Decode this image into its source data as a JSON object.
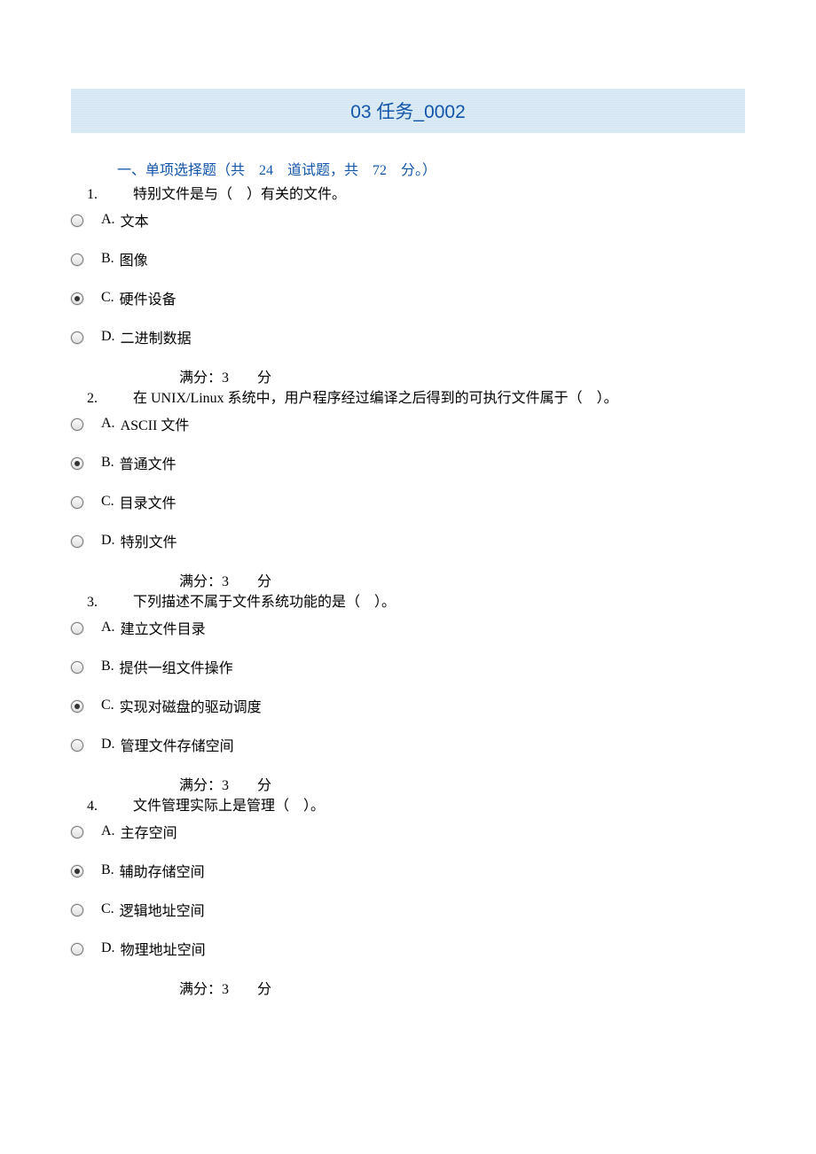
{
  "title": "03 任务_0002",
  "section_header": "一、单项选择题（共　24　道试题，共　72　分。）",
  "score_label_prefix": "满分：",
  "score_value": "3",
  "score_label_suffix": "分",
  "questions": [
    {
      "num": "1.",
      "text": "特别文件是与（　）有关的文件。",
      "options": [
        {
          "label": "A.",
          "text": "文本",
          "selected": false
        },
        {
          "label": "B.",
          "text": "图像",
          "selected": false
        },
        {
          "label": "C.",
          "text": "硬件设备",
          "selected": true
        },
        {
          "label": "D.",
          "text": "二进制数据",
          "selected": false
        }
      ]
    },
    {
      "num": "2.",
      "text": "在 UNIX/Linux 系统中，用户程序经过编译之后得到的可执行文件属于（　）。",
      "options": [
        {
          "label": "A.",
          "text": "ASCII 文件",
          "selected": false
        },
        {
          "label": "B.",
          "text": "普通文件",
          "selected": true
        },
        {
          "label": "C.",
          "text": "目录文件",
          "selected": false
        },
        {
          "label": "D.",
          "text": "特别文件",
          "selected": false
        }
      ]
    },
    {
      "num": "3.",
      "text": "下列描述不属于文件系统功能的是（　）。",
      "options": [
        {
          "label": "A.",
          "text": "建立文件目录",
          "selected": false
        },
        {
          "label": "B.",
          "text": "提供一组文件操作",
          "selected": false
        },
        {
          "label": "C.",
          "text": "实现对磁盘的驱动调度",
          "selected": true
        },
        {
          "label": "D.",
          "text": "管理文件存储空间",
          "selected": false
        }
      ]
    },
    {
      "num": "4.",
      "text": "文件管理实际上是管理（　）。",
      "options": [
        {
          "label": "A.",
          "text": "主存空间",
          "selected": false
        },
        {
          "label": "B.",
          "text": "辅助存储空间",
          "selected": true
        },
        {
          "label": "C.",
          "text": "逻辑地址空间",
          "selected": false
        },
        {
          "label": "D.",
          "text": "物理地址空间",
          "selected": false
        }
      ]
    }
  ]
}
